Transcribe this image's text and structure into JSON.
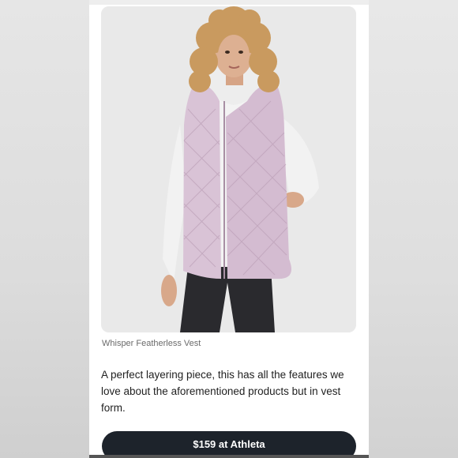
{
  "product": {
    "image_alt": "Woman wearing a pink quilted vest over a white hoodie",
    "caption": "Whisper Featherless Vest",
    "description": "A perfect layering piece, this has all the features we love about the aforementioned products but in vest form."
  },
  "cta": {
    "label": "$159 at Athleta"
  },
  "colors": {
    "vest": "#d9c3d6",
    "button": "#1d232b",
    "card": "#ffffff"
  }
}
